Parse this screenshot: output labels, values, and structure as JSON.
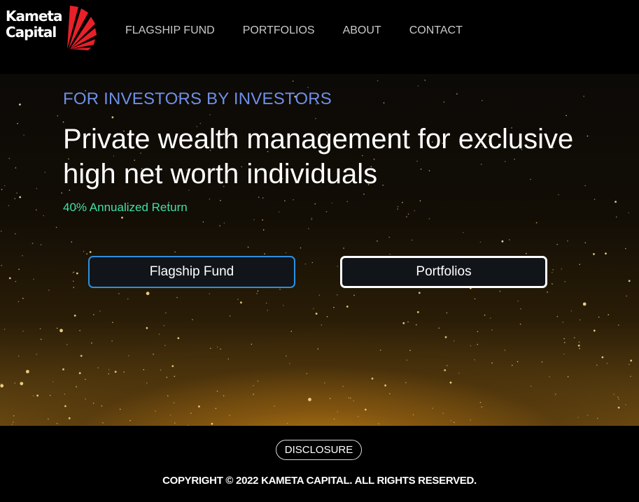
{
  "header": {
    "logo": {
      "line1": "Kameta",
      "line2": "Capital"
    },
    "nav": [
      "FLAGSHIP FUND",
      "PORTFOLIOS",
      "ABOUT",
      "CONTACT"
    ]
  },
  "hero": {
    "eyebrow": "FOR INVESTORS BY INVESTORS",
    "headline": "Private wealth management for exclusive high net worth individuals",
    "stat": "40% Annualized Return",
    "buttons": {
      "fund": "Flagship Fund",
      "portfolios": "Portfolios"
    }
  },
  "footer": {
    "disclosure": "DISCLOSURE",
    "copyright": "COPYRIGHT © 2022 KAMETA CAPITAL. ALL RIGHTS RESERVED."
  },
  "colors": {
    "eyebrow": "#6f8fe6",
    "stat": "#3fe0a6",
    "logo_mark": "#e8202a",
    "fund_button_border": "#2f8fe0"
  }
}
